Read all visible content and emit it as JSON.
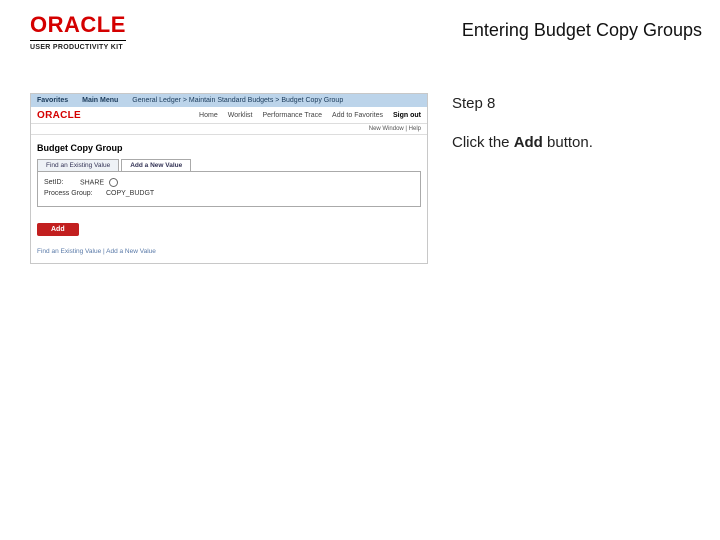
{
  "header": {
    "brand": "ORACLE",
    "kit": "USER PRODUCTIVITY KIT",
    "lesson_title": "Entering Budget Copy Groups"
  },
  "instructions": {
    "step_label": "Step 8",
    "line_prefix": "Click the ",
    "line_bold": "Add",
    "line_suffix": " button."
  },
  "app": {
    "topbar": {
      "item1": "Favorites",
      "item2": "Main Menu",
      "crumb": "General Ledger  >  Maintain Standard Budgets  >  Budget Copy Group"
    },
    "brand_mini": "ORACLE",
    "sec": {
      "l1": "Home",
      "l2": "Worklist",
      "l3": "Performance Trace",
      "l4": "Add to Favorites",
      "l5": "Sign out"
    },
    "newwin": "New Window | Help",
    "module_title": "Budget Copy Group",
    "tabs": {
      "t1": "Find an Existing Value",
      "t2": "Add a New Value"
    },
    "form": {
      "setid_lbl": "SetID:",
      "setid_val": "SHARE",
      "group_lbl": "Process Group:",
      "group_val": "COPY_BUDGT"
    },
    "add_btn": "Add",
    "footer": "Find an Existing Value  |  Add a New Value"
  }
}
